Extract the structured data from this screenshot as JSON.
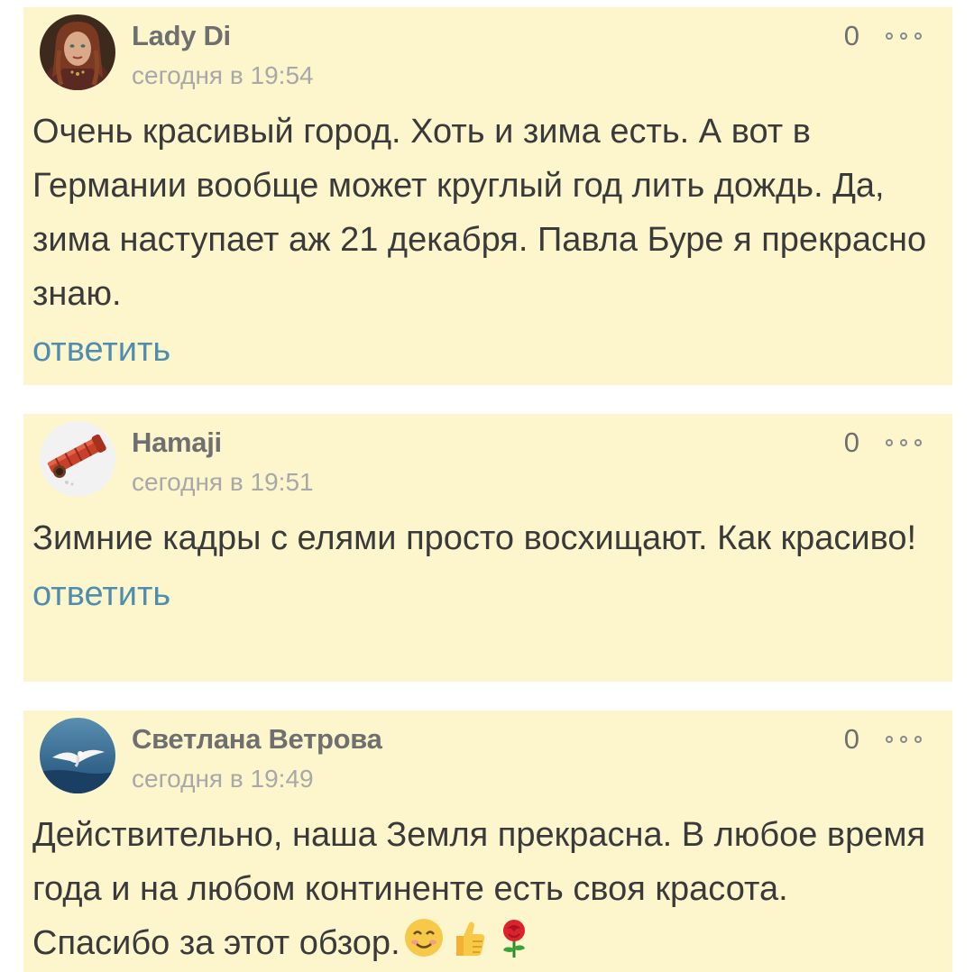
{
  "comments": [
    {
      "author": "Lady Di",
      "time": "сегодня в 19:54",
      "rating": "0",
      "text": "Очень красивый город. Хоть и зима есть. А вот в Германии вообще может круглый год лить дождь. Да, зима наступает аж 21 декабря. Павла Буре я прекрасно знаю.",
      "reply_label": "ответить",
      "avatar_icon": "woman-portrait-avatar"
    },
    {
      "author": "Hamaji",
      "time": "сегодня в 19:51",
      "rating": "0",
      "text": "Зимние кадры с елями просто восхищают. Как красиво!",
      "reply_label": "ответить",
      "avatar_icon": "red-scroll-avatar"
    },
    {
      "author": "Светлана Ветрова",
      "time": "сегодня в 19:49",
      "rating": "0",
      "text": "Действительно, наша Земля прекрасна. В любое время года и на любом континенте есть своя красота. Спасибо за этот обзор.",
      "reply_label": "ответить",
      "avatar_icon": "seagull-over-sea-avatar",
      "emojis": [
        "smiling-face-icon",
        "thumbs-up-icon",
        "rose-icon"
      ]
    }
  ],
  "colors": {
    "card_background": "#fdf6cc",
    "author": "#6f6f6f",
    "time": "#a8a8a8",
    "text": "#3a3a3a",
    "reply_link": "#4f8db0"
  }
}
